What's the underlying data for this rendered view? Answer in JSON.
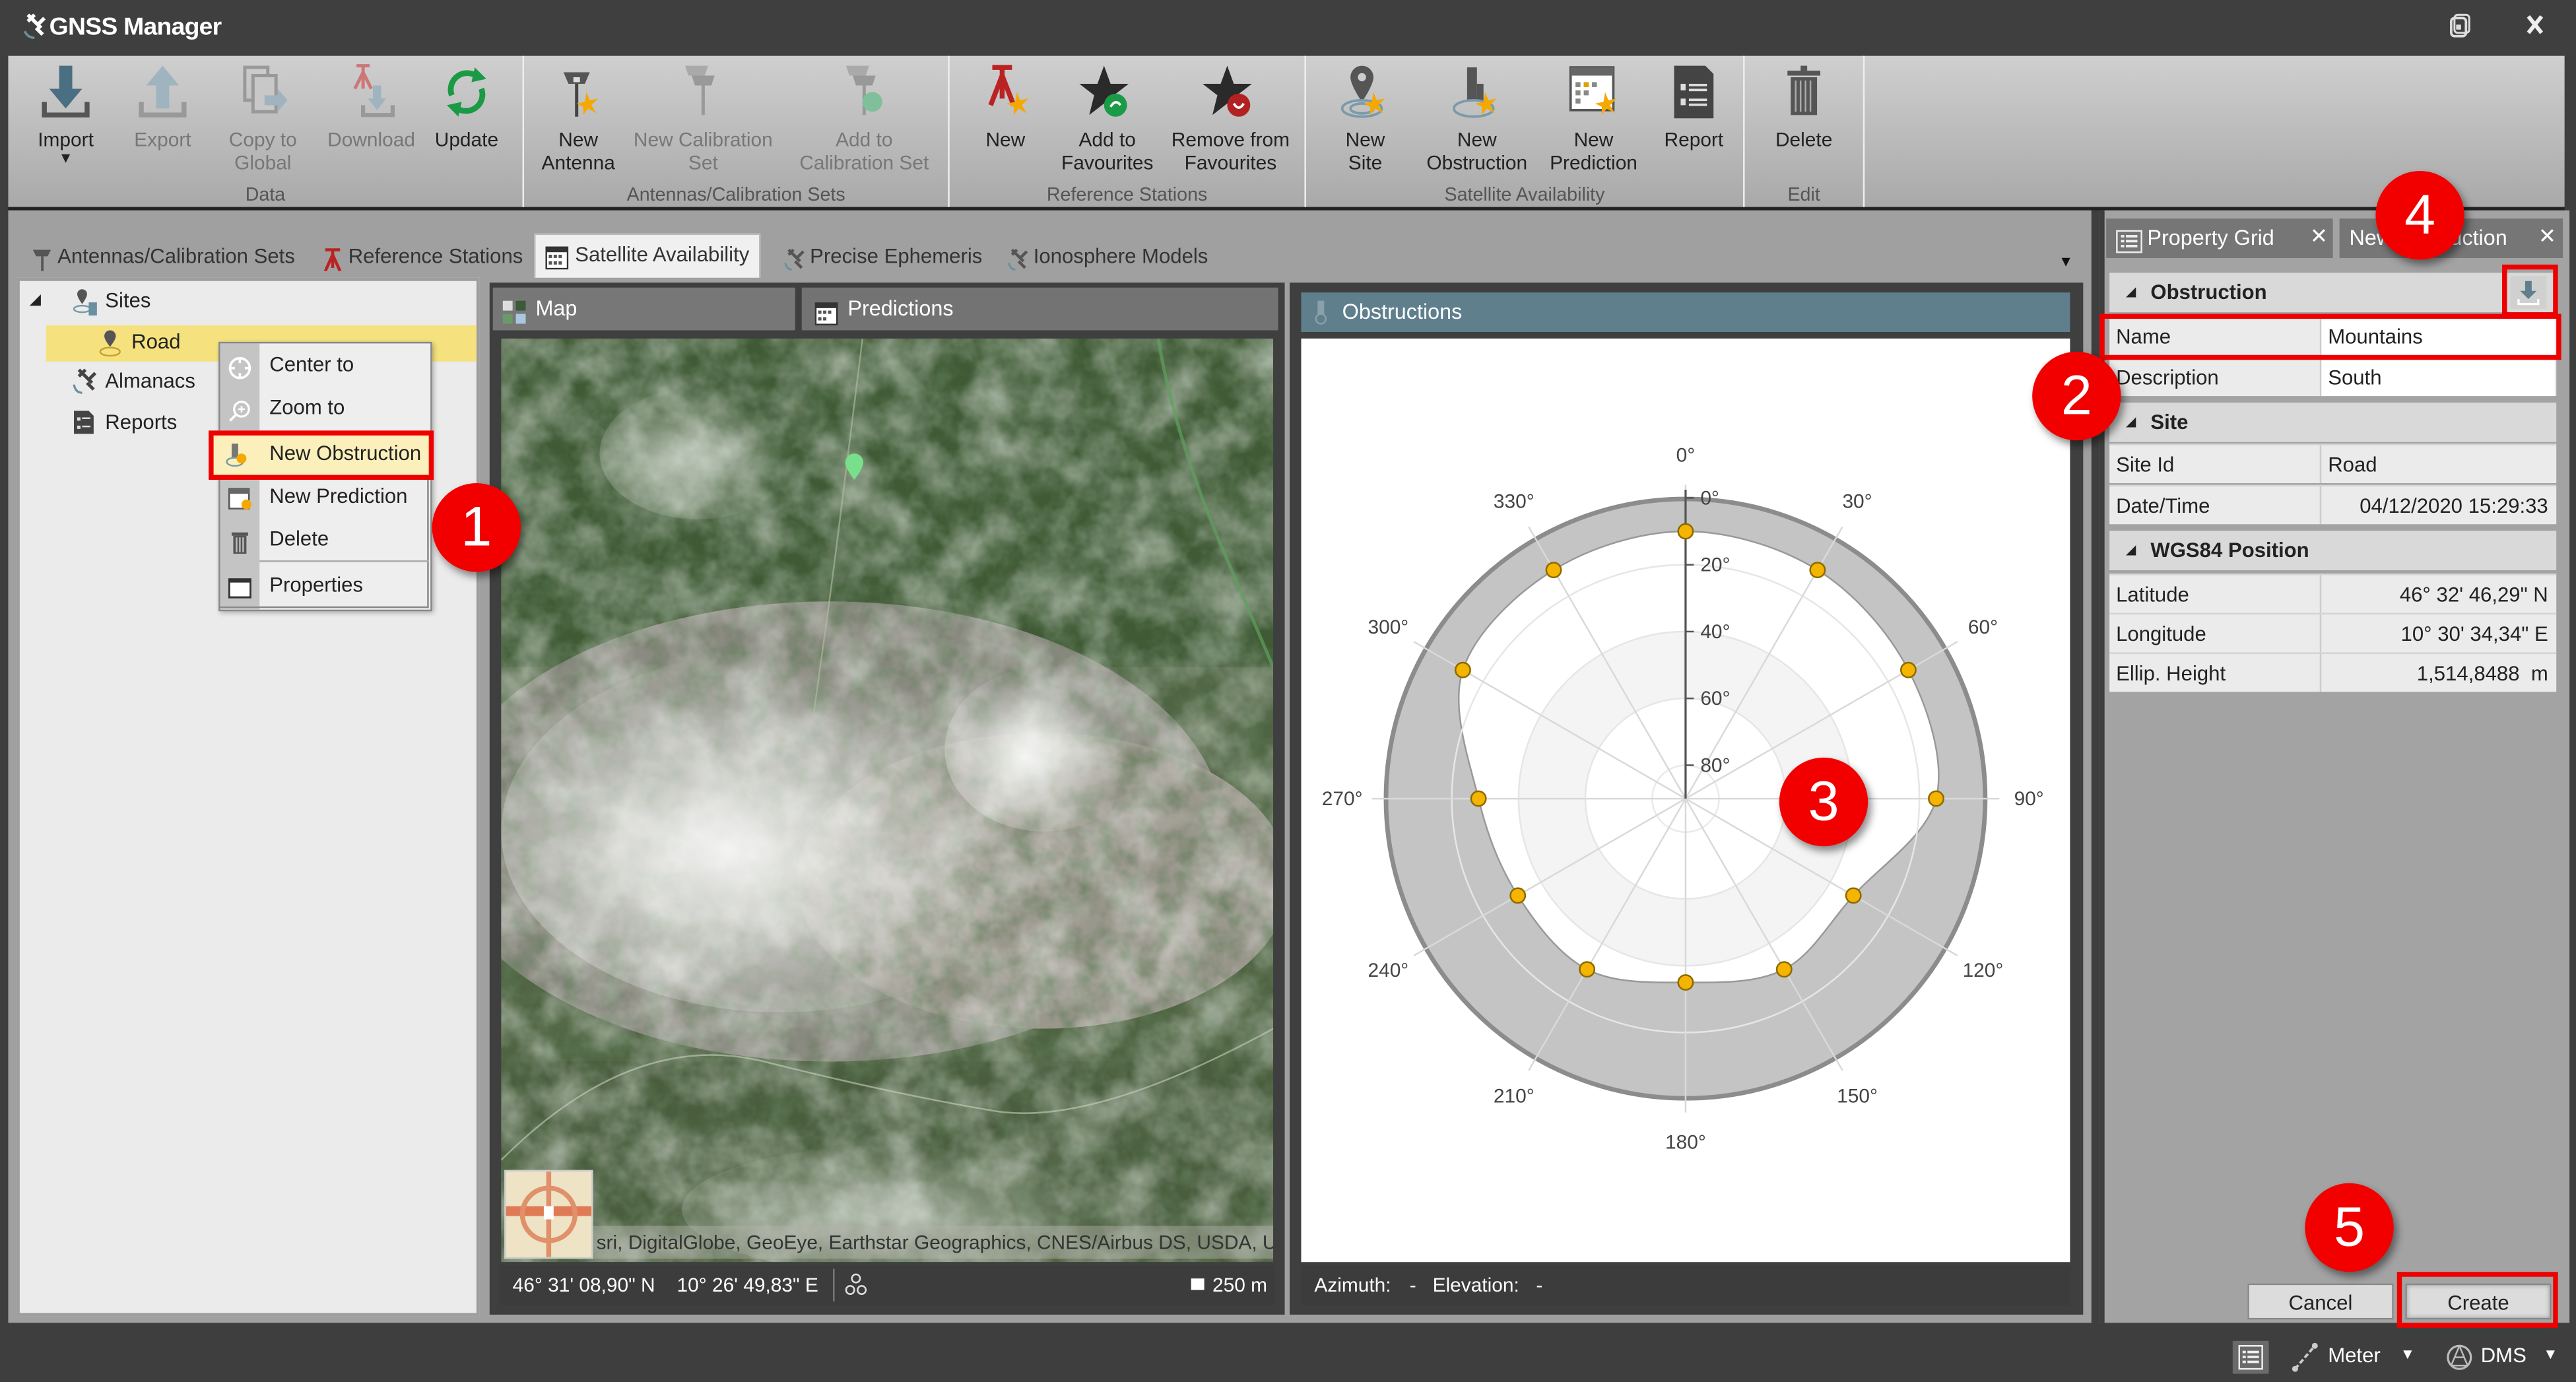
{
  "app": {
    "title": "GNSS Manager",
    "window_controls": [
      "restore",
      "close"
    ]
  },
  "ribbon": {
    "groups": [
      {
        "label": "Data",
        "buttons": [
          {
            "label": "Import",
            "icon": "import-icon",
            "enabled": true,
            "has_dropdown": true
          },
          {
            "label": "Export",
            "icon": "export-icon",
            "enabled": false
          },
          {
            "label": "Copy to Global",
            "icon": "copy-icon",
            "enabled": false
          },
          {
            "label": "Download",
            "icon": "download-icon",
            "enabled": false
          },
          {
            "label": "Update",
            "icon": "refresh-icon",
            "enabled": true
          }
        ]
      },
      {
        "label": "Antennas/Calibration Sets",
        "buttons": [
          {
            "label": "New Antenna",
            "icon": "antenna-icon",
            "enabled": true
          },
          {
            "label": "New Calibration Set",
            "icon": "calibration-set-icon",
            "enabled": false
          },
          {
            "label": "Add to Calibration Set",
            "icon": "add-calibration-icon",
            "enabled": false,
            "has_dropdown": true
          }
        ]
      },
      {
        "label": "Reference Stations",
        "buttons": [
          {
            "label": "New",
            "icon": "tripod-icon",
            "enabled": true
          },
          {
            "label": "Add to Favourites",
            "icon": "star-add-icon",
            "enabled": true
          },
          {
            "label": "Remove from Favourites",
            "icon": "star-remove-icon",
            "enabled": true
          }
        ]
      },
      {
        "label": "Satellite Availability",
        "buttons": [
          {
            "label": "New Site",
            "icon": "site-pin-icon",
            "enabled": true
          },
          {
            "label": "New Obstruction",
            "icon": "obstruction-icon",
            "enabled": true
          },
          {
            "label": "New Prediction",
            "icon": "prediction-calendar-icon",
            "enabled": true
          },
          {
            "label": "Report",
            "icon": "report-icon",
            "enabled": true
          }
        ]
      },
      {
        "label": "Edit",
        "buttons": [
          {
            "label": "Delete",
            "icon": "trash-icon",
            "enabled": true
          }
        ]
      }
    ]
  },
  "doc_tabs": [
    {
      "label": "Antennas/Calibration Sets",
      "icon": "antenna-icon",
      "active": false
    },
    {
      "label": "Reference Stations",
      "icon": "tripod-icon",
      "active": false
    },
    {
      "label": "Satellite Availability",
      "icon": "calendar-icon",
      "active": true
    },
    {
      "label": "Precise Ephemeris",
      "icon": "satellite-icon",
      "active": false
    },
    {
      "label": "Ionosphere Models",
      "icon": "satellite-icon",
      "active": false
    }
  ],
  "tree": {
    "nodes": [
      {
        "label": "Sites",
        "icon": "sites-icon",
        "expanded": true,
        "level": 0
      },
      {
        "label": "Road",
        "icon": "site-pin-icon",
        "selected": true,
        "level": 1
      },
      {
        "label": "Almanacs",
        "icon": "satellite-icon",
        "level": 0
      },
      {
        "label": "Reports",
        "icon": "report-icon",
        "level": 0
      }
    ]
  },
  "context_menu": {
    "items": [
      {
        "label": "Center to",
        "icon": "center-icon"
      },
      {
        "label": "Zoom to",
        "icon": "zoom-icon"
      },
      {
        "label": "New Obstruction",
        "icon": "obstruction-icon",
        "highlighted": true
      },
      {
        "label": "New Prediction",
        "icon": "prediction-calendar-icon"
      },
      {
        "label": "Delete",
        "icon": "trash-icon"
      },
      {
        "label": "Properties",
        "icon": "window-icon"
      }
    ]
  },
  "panes": {
    "map": {
      "tab_map": "Map",
      "tab_predictions": "Predictions",
      "attribution": "sri, DigitalGlobe, GeoEye, Earthstar Geographics, CNES/Airbus DS, USDA, USC",
      "cursor_lat": "46° 31' 08,90\" N",
      "cursor_lon": "10° 26' 49,83\" E",
      "scale": "250 m"
    },
    "obstructions": {
      "title": "Obstructions",
      "azimuth_label": "Azimuth:",
      "azimuth_value": "-",
      "elevation_label": "Elevation:",
      "elevation_value": "-"
    }
  },
  "chart_data": {
    "type": "polar",
    "title": "Obstructions",
    "angular_axis": {
      "label": "Azimuth",
      "ticks": [
        "0°",
        "30°",
        "60°",
        "90°",
        "120°",
        "150°",
        "180°",
        "210°",
        "240°",
        "270°",
        "300°",
        "330°"
      ],
      "range": [
        0,
        360
      ],
      "direction": "clockwise",
      "zero": "north"
    },
    "radial_axis": {
      "label": "Elevation",
      "ticks": [
        "0°",
        "20°",
        "40°",
        "60°",
        "80°"
      ],
      "range": [
        0,
        90
      ],
      "outer_is_zero": true
    },
    "series": [
      {
        "name": "Mountains",
        "azimuth": [
          0,
          30,
          60,
          90,
          120,
          150,
          180,
          210,
          240,
          270,
          300,
          330
        ],
        "elevation": [
          10,
          11,
          13,
          15,
          32,
          31,
          35,
          31,
          32,
          28,
          13,
          11
        ],
        "marker_color": "#f5b400",
        "fill_color": "#c4c4c4"
      }
    ],
    "grid": true
  },
  "right_panel": {
    "tabs": [
      {
        "label": "Property Grid",
        "icon": "property-grid-icon",
        "closable": true
      },
      {
        "label": "New Obstruction",
        "closable": true,
        "active": true
      }
    ],
    "categories": [
      {
        "label": "Obstruction",
        "rows": [
          {
            "key": "Name",
            "value": "Mountains",
            "editable": true
          },
          {
            "key": "Description",
            "value": "South",
            "editable": true
          }
        ]
      },
      {
        "label": "Site",
        "rows": [
          {
            "key": "Site Id",
            "value": "Road"
          },
          {
            "key": "Date/Time",
            "value": "04/12/2020 15:29:33"
          }
        ]
      },
      {
        "label": "WGS84 Position",
        "rows": [
          {
            "key": "Latitude",
            "value": "46° 32' 46,29\" N"
          },
          {
            "key": "Longitude",
            "value": "10° 30' 34,34\" E"
          },
          {
            "key": "Ellip. Height",
            "value": "1,514,8488  m"
          }
        ]
      }
    ],
    "cancel_label": "Cancel",
    "create_label": "Create"
  },
  "statusbar": {
    "unit_label": "Meter",
    "coord_format_label": "DMS"
  },
  "annotations": [
    "1",
    "2",
    "3",
    "4",
    "5"
  ],
  "colors": {
    "accent_red": "#f20000",
    "selection_yellow": "#f5e27e",
    "obstruction_header": "#5f7f8c",
    "marker": "#f5b400"
  }
}
